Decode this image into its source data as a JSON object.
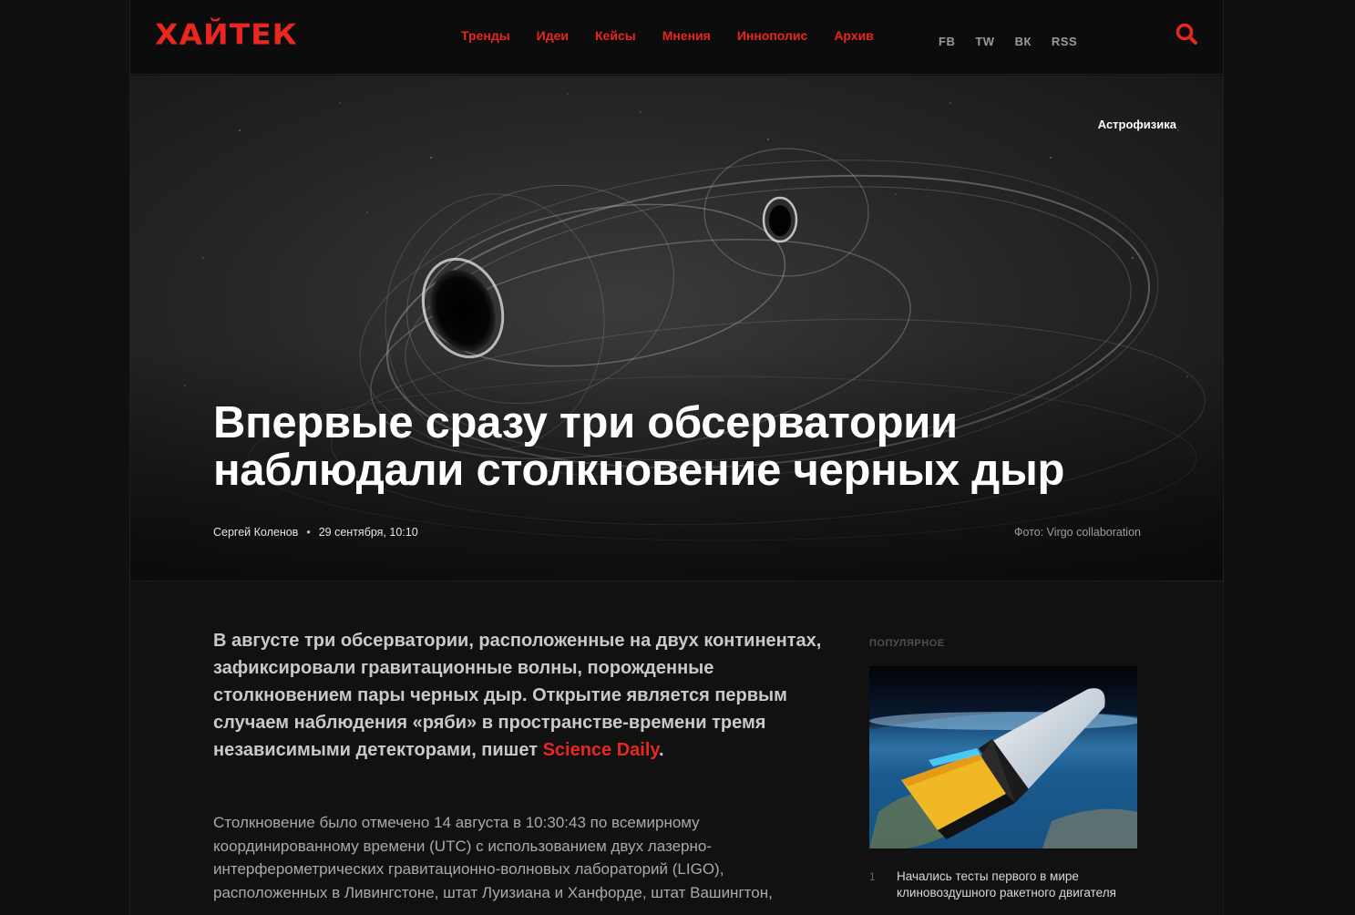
{
  "header": {
    "logo": "ХАЙТЕК",
    "nav": [
      "Тренды",
      "Идеи",
      "Кейсы",
      "Мнения",
      "Иннополис",
      "Архив"
    ],
    "social": [
      "FB",
      "TW",
      "ВК",
      "RSS"
    ],
    "search_icon": "search-icon"
  },
  "hero": {
    "rubric": "Астрофизика",
    "title": "Впервые сразу три обсерватории наблюдали столкновение черных дыр",
    "author": "Сергей Коленов",
    "separator": "•",
    "date": "29 сентября, 10:10",
    "photo_credit": "Фото: Virgo collaboration"
  },
  "article": {
    "lead_text": "В августе три обсерватории, расположенные на двух континентах, зафиксировали гравитационные волны, порожденные столкновением пары черных дыр. Открытие является первым случаем наблюдения «ряби» в пространстве-времени тремя независимыми детекторами, пишет ",
    "lead_link": "Science Daily",
    "lead_end": ".",
    "paragraph": "Столкновение было отмечено 14 августа в 10:30:43 по всемирному координированному времени (UTC) с использованием двух лазерно-интерферометрических гравитационно-волновых лабораторий (LIGO), расположенных в Ливингстоне, штат Луизиана и Ханфорде, штат Вашингтон,"
  },
  "sidebar": {
    "title": "ПОПУЛЯРНОЕ",
    "items": [
      {
        "num": "1",
        "text": "Начались тесты первого в мире клиновоздушного ракетного двигателя"
      }
    ]
  },
  "colors": {
    "accent": "#e8271e",
    "background": "#111111"
  }
}
